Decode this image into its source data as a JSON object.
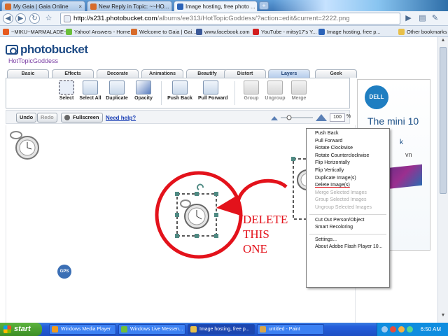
{
  "browser": {
    "tabs": [
      {
        "label": "My Gaia | Gaia Online",
        "active": false
      },
      {
        "label": "New Reply in Topic: ~~HO...",
        "active": false
      },
      {
        "label": "Image hosting, free photo ...",
        "active": true
      }
    ],
    "url_host": "http://s231.photobucket.com",
    "url_path": "/albums/ee313/HotTopicGoddess/?action=edit&current=2222.png",
    "bookmarks": [
      "~MIKU~MARMALADE~",
      "Yahoo! Answers - Home",
      "Welcome to Gaia | Gai...",
      "www.facebook.com",
      "YouTube - mitsy17's Y...",
      "Image hosting, free p..."
    ],
    "other_bookmarks": "Other bookmarks"
  },
  "page": {
    "logo_text": "photobucket",
    "username": "HotTopicGoddess",
    "menu_tabs": [
      "Basic",
      "Effects",
      "Decorate",
      "Animations",
      "Beautify",
      "Distort",
      "Layers",
      "Geek"
    ],
    "active_menu_tab": "Layers",
    "tools": [
      "Select",
      "Select All",
      "Duplicate",
      "Opacity",
      "Push Back",
      "Pull Forward",
      "Group",
      "Ungroup",
      "Merge"
    ],
    "undo": "Undo",
    "redo": "Redo",
    "fullscreen": "Fullscreen",
    "help": "Need help?",
    "zoom": "100",
    "zoom_unit": "%"
  },
  "annotation": {
    "line1": "DELETE",
    "line2": "THIS",
    "line3": "ONE"
  },
  "context_menu": {
    "items": [
      {
        "label": "Push Back",
        "enabled": true
      },
      {
        "label": "Pull Forward",
        "enabled": true
      },
      {
        "label": "Rotate Clockwise",
        "enabled": true
      },
      {
        "label": "Rotate Counterclockwise",
        "enabled": true
      },
      {
        "label": "Flip Horizontally",
        "enabled": true
      },
      {
        "label": "Flip Vertically",
        "enabled": true
      },
      {
        "label": "Duplicate Image(s)",
        "enabled": true
      },
      {
        "label": "Delete Image(s)",
        "enabled": true
      },
      {
        "label": "Merge Selected Images",
        "enabled": false
      },
      {
        "label": "Group Selected Images",
        "enabled": false
      },
      {
        "label": "Ungroup Selected Images",
        "enabled": false
      },
      {
        "label": "Cut Out Person/Object",
        "enabled": true
      },
      {
        "label": "Smart Recoloring",
        "enabled": true
      },
      {
        "label": "Settings...",
        "enabled": true
      },
      {
        "label": "About Adobe Flash Player 10...",
        "enabled": true
      }
    ]
  },
  "ad": {
    "brand": "DELL",
    "headline": "The mini 10",
    "line2": "k",
    "line3": "vn",
    "badge": "GPS"
  },
  "taskbar": {
    "start": "start",
    "tasks": [
      "Windows Media Player",
      "Windows Live Messen...",
      "Image hosting, free p...",
      "untitled - Paint"
    ],
    "clock": "6:50 AM"
  },
  "colors": {
    "annotation_red": "#e3121b",
    "active_tab": "#b6cdec",
    "taskbar": "#245edb"
  }
}
